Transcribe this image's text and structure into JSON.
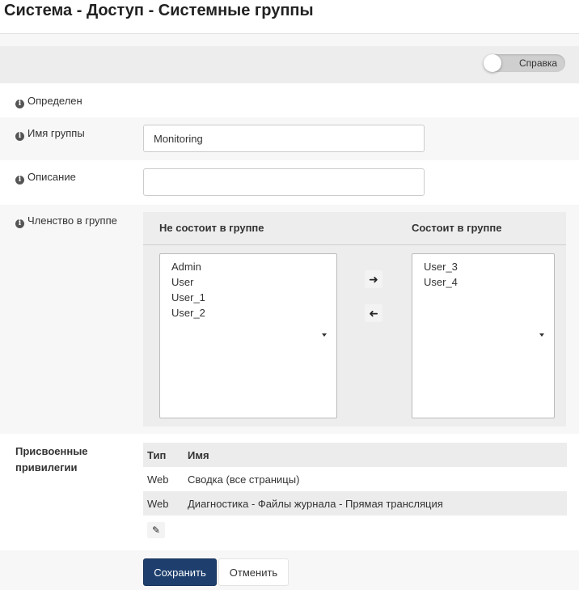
{
  "page": {
    "title": "Система - Доступ - Системные группы"
  },
  "help_toggle": {
    "label": "Справка",
    "on": false
  },
  "fields": {
    "defined_label": "Определен",
    "group_name_label": "Имя группы",
    "group_name_value": "Monitoring",
    "description_label": "Описание",
    "description_value": "",
    "membership_label": "Членство в группе"
  },
  "membership": {
    "not_member_header": "Не состоит в группе",
    "member_header": "Состоит в группе",
    "not_members": [
      "Admin",
      "User",
      "User_1",
      "User_2"
    ],
    "members": [
      "User_3",
      "User_4"
    ],
    "add_icon": "arrow-right-icon",
    "remove_icon": "arrow-left-icon"
  },
  "privileges": {
    "label": "Присвоенные привилегии",
    "columns": [
      "Тип",
      "Имя"
    ],
    "rows": [
      {
        "type": "Web",
        "name": "Сводка (все страницы)"
      },
      {
        "type": "Web",
        "name": "Диагностика - Файлы журнала - Прямая трансляция"
      }
    ],
    "edit_icon": "pencil-icon"
  },
  "actions": {
    "save_label": "Сохранить",
    "cancel_label": "Отменить",
    "primary_color": "#1e3f6e"
  }
}
